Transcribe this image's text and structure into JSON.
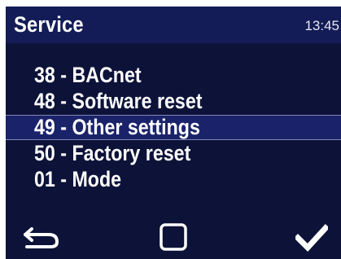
{
  "header": {
    "title": "Service",
    "time": "13:45"
  },
  "menu": {
    "items": [
      {
        "label": "38 - BACnet",
        "selected": false
      },
      {
        "label": "48 - Software reset",
        "selected": false
      },
      {
        "label": "49 - Other settings",
        "selected": true
      },
      {
        "label": "50 - Factory reset",
        "selected": false
      },
      {
        "label": "01 - Mode",
        "selected": false
      }
    ]
  },
  "footer": {
    "buttons": [
      {
        "icon": "back-arrow-icon"
      },
      {
        "icon": "square-icon"
      },
      {
        "icon": "checkmark-icon"
      }
    ]
  },
  "colors": {
    "background": "#0c1238",
    "header_background": "#131c56",
    "selected_background": "#1a236a",
    "selected_border": "#7f86b4",
    "text": "#ffffff"
  }
}
